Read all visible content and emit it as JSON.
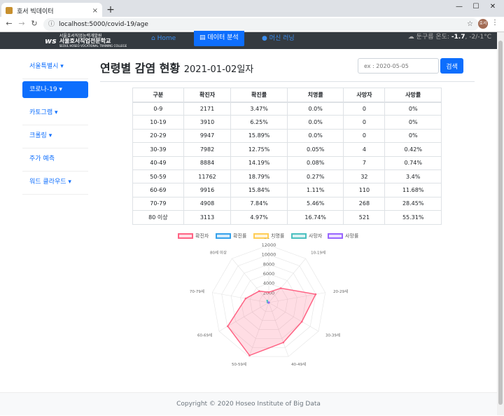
{
  "browser": {
    "tab_title": "호서 빅데이터",
    "tab_close": "×",
    "new_tab": "+",
    "url": "localhost:5000/covid-19/age",
    "avatar_text": "호서",
    "win_min": "—",
    "win_max": "☐",
    "win_close": "✕"
  },
  "navbar": {
    "logo_mark": "ws",
    "logo_line1": "서울호서직업능력개발원",
    "logo_line2": "서울호서직업전문학교",
    "logo_line3": "SEOUL HOSEO VOCATIONAL TRAINING COLLEGE",
    "home": "Home",
    "analysis": "데이터 분석",
    "ml": "머신 러닝",
    "weather_label": "둔구름 온도:",
    "weather_value": "-1.7",
    "weather_range": ", -2/-1°C"
  },
  "sidebar": {
    "items": [
      {
        "label": "서울특별시 ▾"
      },
      {
        "label": "코로나-19 ▾"
      },
      {
        "label": "카토그램 ▾"
      },
      {
        "label": "크롤링 ▾"
      },
      {
        "label": "주가 예측"
      },
      {
        "label": "워드 클라우드 ▾"
      }
    ]
  },
  "page": {
    "title": "연령별 감염 현황",
    "date": "2021-01-02일자",
    "search_placeholder": "ex : 2020-05-05",
    "search_button": "검색"
  },
  "table": {
    "headers": [
      "구분",
      "확진자",
      "확진률",
      "치명률",
      "사망자",
      "사망률"
    ],
    "rows": [
      [
        "0-9",
        "2171",
        "3.47%",
        "0.0%",
        "0",
        "0%"
      ],
      [
        "10-19",
        "3910",
        "6.25%",
        "0.0%",
        "0",
        "0%"
      ],
      [
        "20-29",
        "9947",
        "15.89%",
        "0.0%",
        "0",
        "0%"
      ],
      [
        "30-39",
        "7982",
        "12.75%",
        "0.05%",
        "4",
        "0.42%"
      ],
      [
        "40-49",
        "8884",
        "14.19%",
        "0.08%",
        "7",
        "0.74%"
      ],
      [
        "50-59",
        "11762",
        "18.79%",
        "0.27%",
        "32",
        "3.4%"
      ],
      [
        "60-69",
        "9916",
        "15.84%",
        "1.11%",
        "110",
        "11.68%"
      ],
      [
        "70-79",
        "4908",
        "7.84%",
        "5.46%",
        "268",
        "28.45%"
      ],
      [
        "80 이상",
        "3113",
        "4.97%",
        "16.74%",
        "521",
        "55.31%"
      ]
    ]
  },
  "chart_data": {
    "type": "radar",
    "categories": [
      "0-9세",
      "10-19세",
      "20-29세",
      "30-39세",
      "40-49세",
      "50-59세",
      "60-69세",
      "70-79세",
      "80세 이상"
    ],
    "rlim": [
      0,
      12000
    ],
    "ticks": [
      "2000",
      "4000",
      "6000",
      "8000",
      "10000",
      "12000"
    ],
    "series": [
      {
        "name": "확진자",
        "color": "#ff6384",
        "values": [
          2171,
          3910,
          9947,
          7982,
          8884,
          11762,
          9916,
          4908,
          3113
        ]
      },
      {
        "name": "확진률",
        "color": "#36a2eb",
        "values": [
          3.47,
          6.25,
          15.89,
          12.75,
          14.19,
          18.79,
          15.84,
          7.84,
          4.97
        ]
      },
      {
        "name": "치명률",
        "color": "#ffcd56",
        "values": [
          0.0,
          0.0,
          0.0,
          0.05,
          0.08,
          0.27,
          1.11,
          5.46,
          16.74
        ]
      },
      {
        "name": "사망자",
        "color": "#4bc0c0",
        "values": [
          0,
          0,
          0,
          4,
          7,
          32,
          110,
          268,
          521
        ]
      },
      {
        "name": "사망률",
        "color": "#9966ff",
        "values": [
          0,
          0,
          0,
          0.42,
          0.74,
          3.4,
          11.68,
          28.45,
          55.31
        ]
      }
    ]
  },
  "footer": {
    "text": "Copyright © 2020 Hoseo Institute of Big Data"
  }
}
